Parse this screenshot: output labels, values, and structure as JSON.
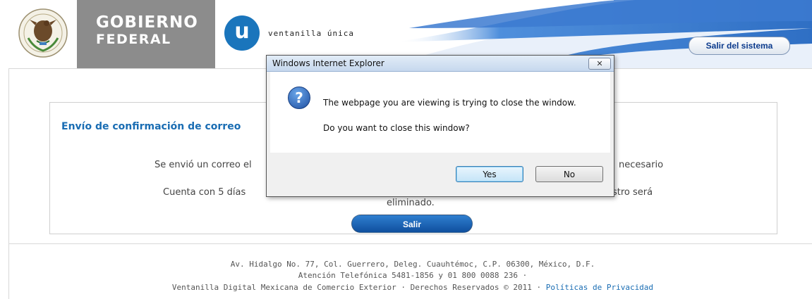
{
  "header": {
    "gob_line1": "Gobierno",
    "gob_line2": "Federal",
    "vu_logo_letter": "u",
    "vu_text": "ventanilla única",
    "logout_label": "Salir del sistema"
  },
  "content": {
    "title": "Envío de confirmación de correo",
    "line1_left": "Se envió un correo el",
    "line1_right": "necesario",
    "line2_left": "Cuenta con  5  días",
    "line2_right": "stro será",
    "line3": "eliminado.",
    "salir_label": "Salir"
  },
  "footer": {
    "address": "Av. Hidalgo No. 77, Col. Guerrero, Deleg. Cuauhtémoc, C.P. 06300, México, D.F.",
    "phone": "Atención Telefónica 5481-1856 y 01 800 0088 236 ·",
    "rights": "Ventanilla Digital Mexicana de Comercio Exterior · Derechos Reservados © 2011 ·",
    "privacy_link": "Políticas de Privacidad"
  },
  "dialog": {
    "title": "Windows Internet Explorer",
    "close_glyph": "✕",
    "icon_glyph": "?",
    "message1": "The webpage you are viewing is trying to close the window.",
    "message2": "Do you want to close this window?",
    "yes_label": "Yes",
    "no_label": "No"
  },
  "colors": {
    "accent_blue": "#1a6db3",
    "logo_blue": "#1a75bc",
    "gob_gray": "#8c8c8c"
  }
}
